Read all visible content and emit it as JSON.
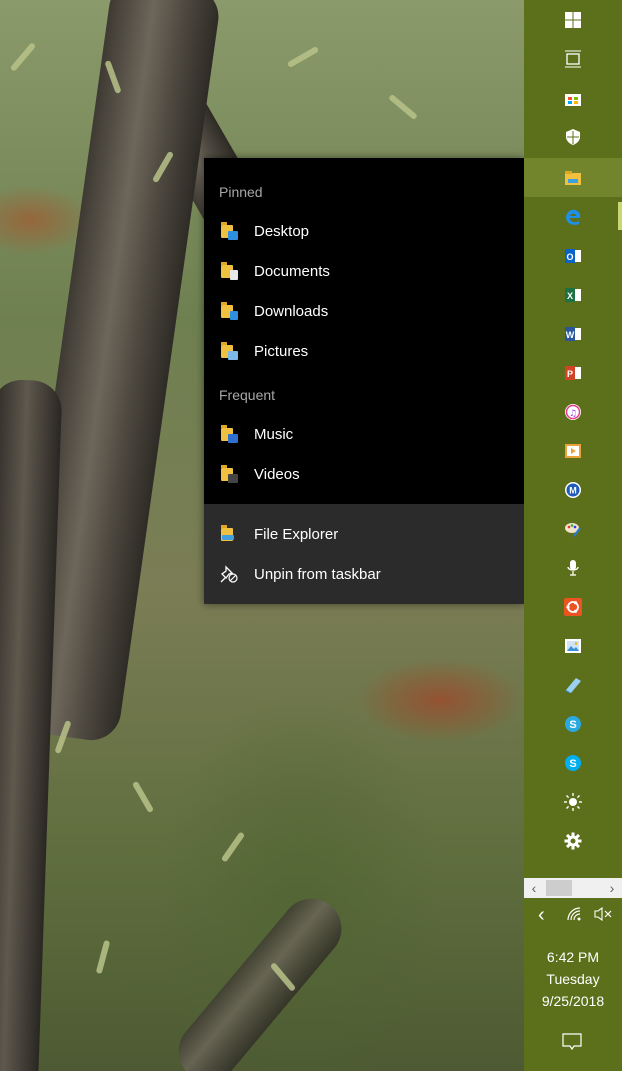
{
  "jump_list": {
    "pinned_header": "Pinned",
    "pinned": [
      {
        "label": "Desktop",
        "icon": "desktop-folder-icon"
      },
      {
        "label": "Documents",
        "icon": "documents-folder-icon"
      },
      {
        "label": "Downloads",
        "icon": "downloads-folder-icon"
      },
      {
        "label": "Pictures",
        "icon": "pictures-folder-icon"
      }
    ],
    "frequent_header": "Frequent",
    "frequent": [
      {
        "label": "Music",
        "icon": "music-folder-icon"
      },
      {
        "label": "Videos",
        "icon": "videos-folder-icon"
      }
    ],
    "tasks": [
      {
        "label": "File Explorer",
        "icon": "file-explorer-icon"
      },
      {
        "label": "Unpin from taskbar",
        "icon": "unpin-icon"
      }
    ]
  },
  "taskbar": {
    "accent_color": "#5c6f1b",
    "items": [
      {
        "icon": "windows-start-icon"
      },
      {
        "icon": "task-view-icon"
      },
      {
        "icon": "microsoft-store-icon"
      },
      {
        "icon": "windows-security-icon"
      },
      {
        "icon": "file-explorer-icon",
        "active": true
      },
      {
        "icon": "edge-icon"
      },
      {
        "icon": "outlook-icon"
      },
      {
        "icon": "excel-icon"
      },
      {
        "icon": "word-icon"
      },
      {
        "icon": "powerpoint-icon"
      },
      {
        "icon": "itunes-icon"
      },
      {
        "icon": "movies-tv-icon"
      },
      {
        "icon": "malwarebytes-icon"
      },
      {
        "icon": "paint-icon"
      },
      {
        "icon": "voice-recorder-icon"
      },
      {
        "icon": "ubuntu-icon"
      },
      {
        "icon": "photos-icon"
      },
      {
        "icon": "notes-icon"
      },
      {
        "icon": "skype-business-icon"
      },
      {
        "icon": "skype-icon"
      },
      {
        "icon": "brightness-icon"
      },
      {
        "icon": "settings-icon"
      }
    ]
  },
  "tray": {
    "chevron": "‹",
    "scroll_left": "‹",
    "scroll_right": "›"
  },
  "clock": {
    "time": "6:42 PM",
    "day": "Tuesday",
    "date": "9/25/2018"
  }
}
